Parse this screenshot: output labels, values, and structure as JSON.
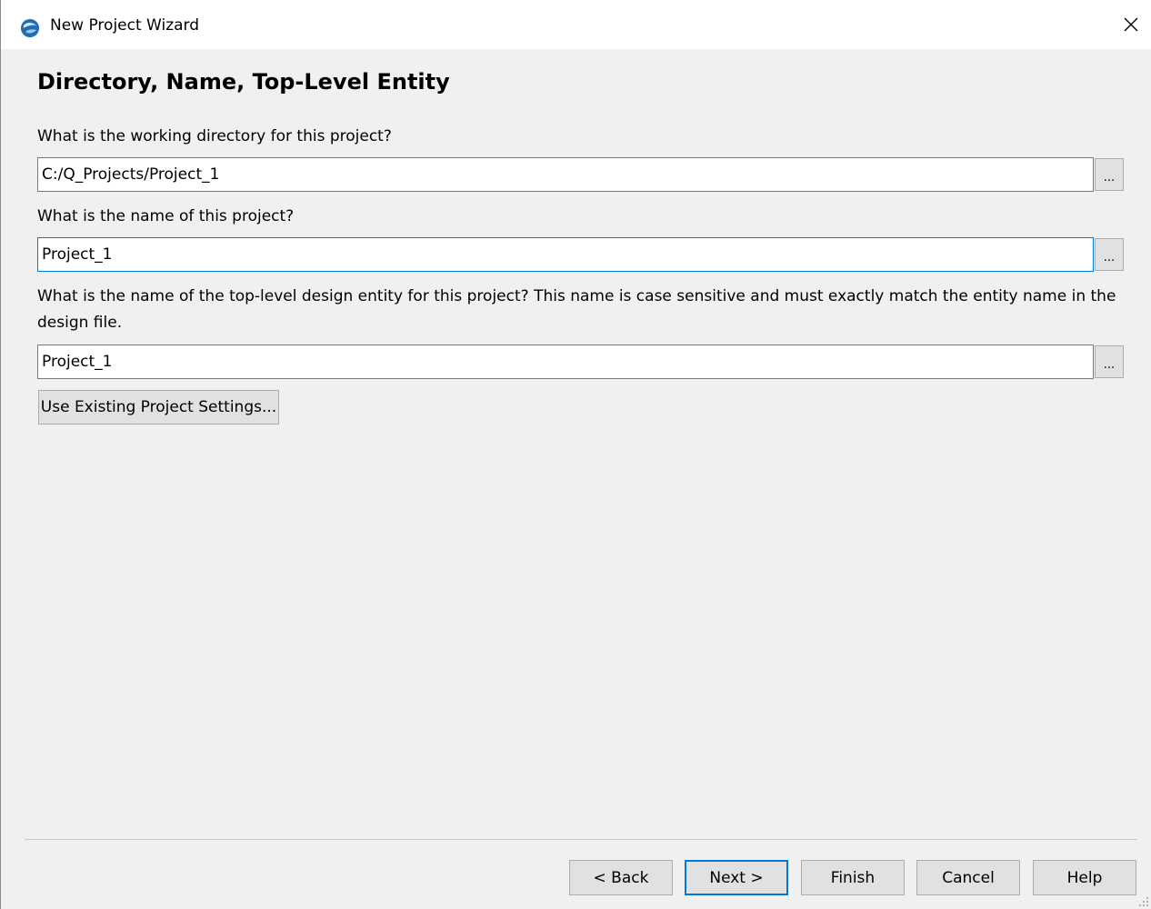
{
  "window": {
    "title": "New Project Wizard"
  },
  "page": {
    "title": "Directory, Name, Top-Level Entity"
  },
  "fields": {
    "directory_label": "What is the working directory for this project?",
    "directory_value": "C:/Q_Projects/Project_1",
    "name_label": "What is the name of this project?",
    "name_value": "Project_1",
    "entity_label": "What is the name of the top-level design entity for this project? This name is case sensitive and must exactly match the entity name in the design file.",
    "entity_value": "Project_1",
    "browse_label": "..."
  },
  "buttons": {
    "use_existing": "Use Existing Project Settings...",
    "back": "< Back",
    "next": "Next >",
    "finish": "Finish",
    "cancel": "Cancel",
    "help": "Help"
  },
  "colors": {
    "accent": "#0078d7",
    "background": "#f0f0f0"
  },
  "icons": {
    "app": "quartus-globe-icon",
    "close": "close-icon"
  }
}
